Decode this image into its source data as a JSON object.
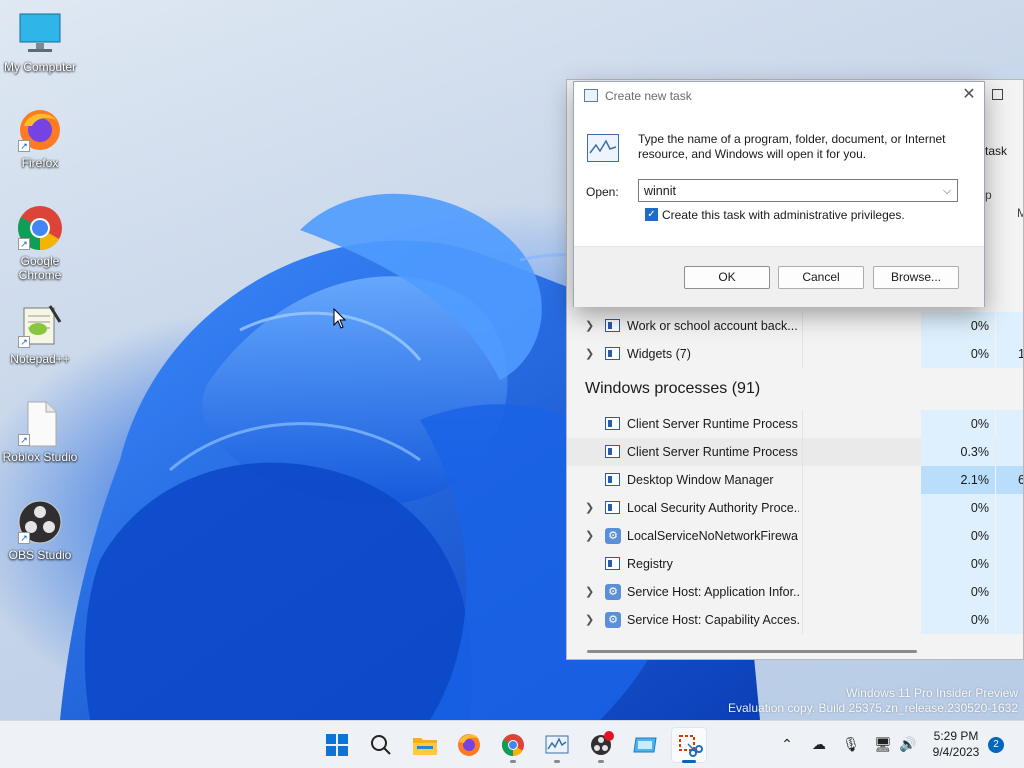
{
  "desktop": {
    "icons": [
      {
        "label": "My Computer"
      },
      {
        "label": "Firefox"
      },
      {
        "label": "Google Chrome"
      },
      {
        "label": "Notepad++"
      },
      {
        "label": "Roblox Studio"
      },
      {
        "label": "OBS Studio"
      }
    ],
    "watermark": {
      "line1": "Windows 11 Pro Insider Preview",
      "line2": "Evaluation copy. Build 25375.zn_release.230520-1632"
    }
  },
  "task_manager": {
    "run_new_task_label": "task",
    "header_partial_1": "p",
    "header_partial_2": "M",
    "rows": [
      {
        "name": "Work or school account back...",
        "cpu": "0%",
        "mem": "",
        "expandable": true,
        "icon": "window-icon"
      },
      {
        "name": "Widgets (7)",
        "cpu": "0%",
        "mem": "1",
        "expandable": true,
        "icon": "window-icon"
      }
    ],
    "section": {
      "title": "Windows processes (91)"
    },
    "win_rows": [
      {
        "name": "Client Server Runtime Process",
        "cpu": "0%",
        "mem": "",
        "expandable": false,
        "icon": "window-icon"
      },
      {
        "name": "Client Server Runtime Process",
        "cpu": "0.3%",
        "mem": "",
        "expandable": false,
        "icon": "window-icon"
      },
      {
        "name": "Desktop Window Manager",
        "cpu": "2.1%",
        "mem": "6",
        "expandable": false,
        "icon": "window-icon"
      },
      {
        "name": "Local Security Authority Proce...",
        "cpu": "0%",
        "mem": "",
        "expandable": true,
        "icon": "window-icon"
      },
      {
        "name": "LocalServiceNoNetworkFirewa...",
        "cpu": "0%",
        "mem": "",
        "expandable": true,
        "icon": "gear-icon"
      },
      {
        "name": "Registry",
        "cpu": "0%",
        "mem": "",
        "expandable": false,
        "icon": "window-icon"
      },
      {
        "name": "Service Host: Application Infor...",
        "cpu": "0%",
        "mem": "",
        "expandable": true,
        "icon": "gear-icon"
      },
      {
        "name": "Service Host: Capability Acces...",
        "cpu": "0%",
        "mem": "",
        "expandable": true,
        "icon": "gear-icon"
      }
    ]
  },
  "dialog": {
    "title": "Create new task",
    "message": "Type the name of a program, folder, document, or Internet resource, and Windows will open it for you.",
    "open_label": "Open:",
    "open_value": "winnit",
    "admin_checkbox_label": "Create this task with administrative privileges.",
    "admin_checked": true,
    "ok_label": "OK",
    "cancel_label": "Cancel",
    "browse_label": "Browse..."
  },
  "taskbar": {
    "apps": [
      {
        "icon": "windows-start-icon"
      },
      {
        "icon": "search-icon"
      },
      {
        "icon": "file-explorer-icon"
      },
      {
        "icon": "firefox-icon"
      },
      {
        "icon": "chrome-icon"
      },
      {
        "icon": "task-manager-icon"
      },
      {
        "icon": "obs-studio-icon"
      },
      {
        "icon": "remote-desktop-icon"
      },
      {
        "icon": "snipping-tool-icon"
      }
    ],
    "time": "5:29 PM",
    "date": "9/4/2023",
    "notification_count": "2"
  }
}
